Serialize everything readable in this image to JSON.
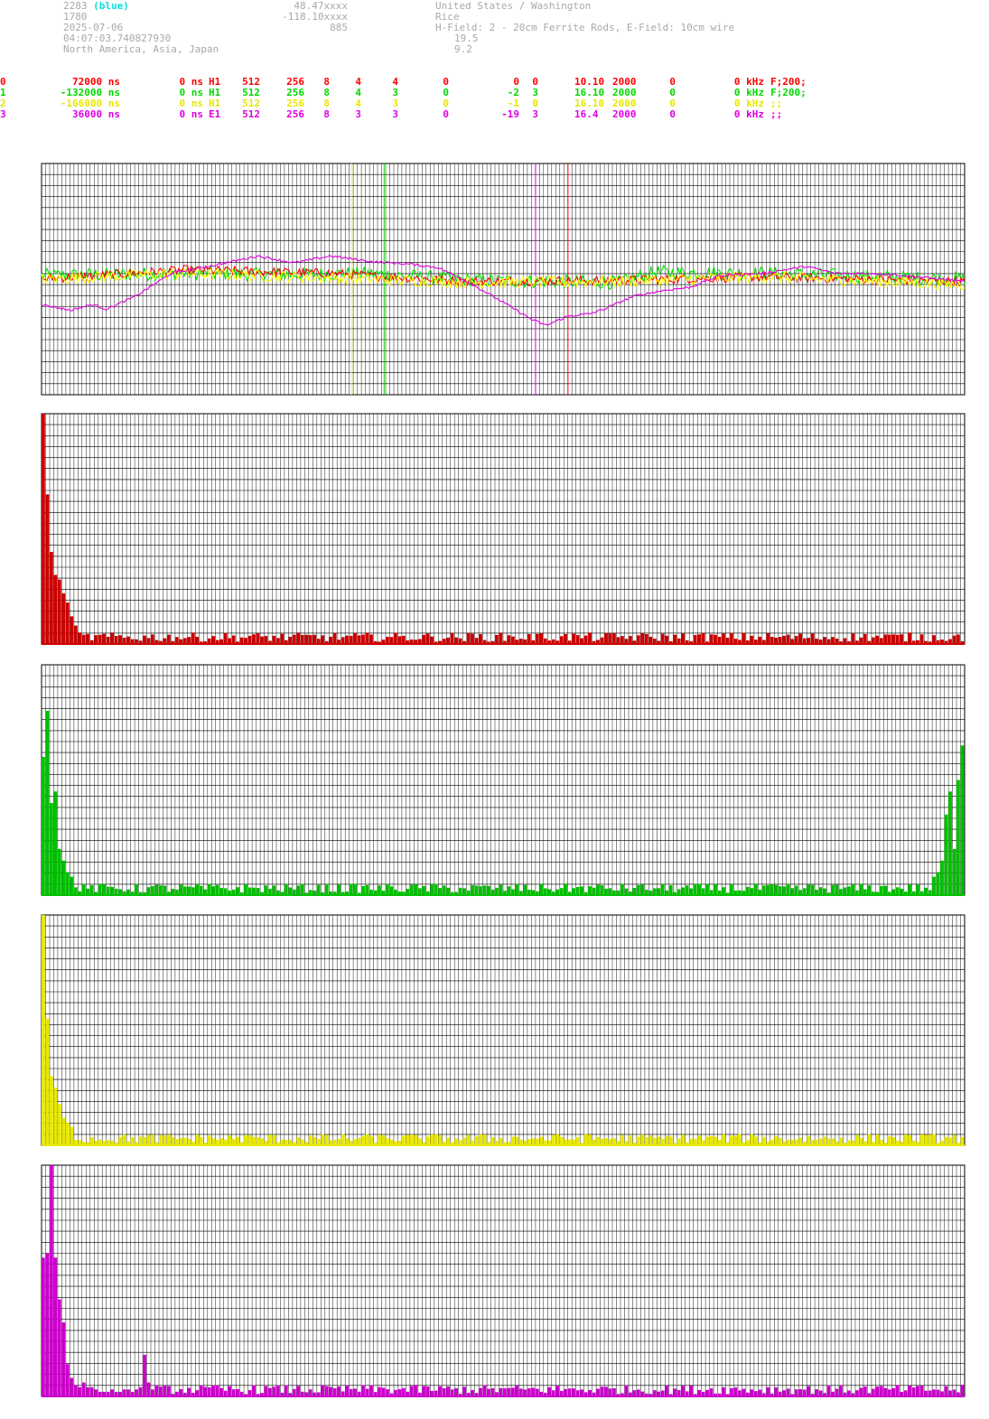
{
  "header": {
    "station_id": "2283",
    "station_color": "(blue)",
    "line2": "1780",
    "date": "2025-07-06",
    "time": "04:07:03.740827930",
    "regions": "North America, Asia, Japan",
    "lat": "48.47xxxx",
    "lon": "-118.10xxxx",
    "alt": "885",
    "location": "United States / Washington",
    "operator": "Rice",
    "antenna": "H-Field: 2 - 20cm Ferrite Rods, E-Field: 10cm wire",
    "val1": "19.5",
    "val2": "9.2"
  },
  "channels": [
    {
      "ch": "0",
      "offset": "72000 ns",
      "delay": "0 ns",
      "type": "H1",
      "a": "512",
      "b": "256",
      "c": "8",
      "d": "4",
      "e": "4",
      "f": "0",
      "g": "0",
      "h": "0",
      "freq": "10.10",
      "rate": "2000",
      "k": "0",
      "kHz": "0 kHz",
      "filter": "F;200;"
    },
    {
      "ch": "1",
      "offset": "-132000 ns",
      "delay": "0 ns",
      "type": "H1",
      "a": "512",
      "b": "256",
      "c": "8",
      "d": "4",
      "e": "3",
      "f": "0",
      "g": "-2",
      "h": "3",
      "freq": "16.10",
      "rate": "2000",
      "k": "0",
      "kHz": "0 kHz",
      "filter": "F;200;"
    },
    {
      "ch": "2",
      "offset": "-166000 ns",
      "delay": "0 ns",
      "type": "H1",
      "a": "512",
      "b": "256",
      "c": "8",
      "d": "4",
      "e": "3",
      "f": "0",
      "g": "-1",
      "h": "0",
      "freq": "16.10",
      "rate": "2000",
      "k": "0",
      "kHz": "0 kHz",
      "filter": ";;"
    },
    {
      "ch": "3",
      "offset": "36000 ns",
      "delay": "0 ns",
      "type": "E1",
      "a": "512",
      "b": "256",
      "c": "8",
      "d": "3",
      "e": "3",
      "f": "0",
      "g": "-19",
      "h": "3",
      "freq": "16.4",
      "rate": "2000",
      "k": "0",
      "kHz": "0 kHz",
      "filter": ";;"
    }
  ],
  "colors": {
    "ch0": "#ff0000",
    "ch0_bar": "#cc0000",
    "ch1": "#00e000",
    "ch1_bar": "#00c000",
    "ch2": "#ffff00",
    "ch2_bar": "#e8e800",
    "ch3": "#e000e0",
    "ch3_bar": "#cc00cc",
    "grid": "#000000"
  },
  "chart_data": [
    {
      "type": "line",
      "xlim": [
        0,
        256
      ],
      "ylim": [
        -1,
        1
      ],
      "grid": true,
      "markers": [
        {
          "channel": "2",
          "x": 86
        },
        {
          "channel": "1",
          "x": 95
        },
        {
          "channel": "3",
          "x": 137
        },
        {
          "channel": "0",
          "x": 146
        }
      ],
      "series": [
        {
          "name": "0",
          "color": "#ff0000",
          "trend": [
            [
              0,
              0.0
            ],
            [
              40,
              0.08
            ],
            [
              80,
              0.05
            ],
            [
              90,
              0.03
            ],
            [
              120,
              -0.02
            ],
            [
              160,
              -0.01
            ],
            [
              200,
              0.02
            ],
            [
              256,
              -0.02
            ]
          ],
          "noise": 0.04
        },
        {
          "name": "1",
          "color": "#00e000",
          "trend": [
            [
              0,
              0.03
            ],
            [
              40,
              0.05
            ],
            [
              70,
              0.04
            ],
            [
              90,
              0.05
            ],
            [
              120,
              -0.01
            ],
            [
              160,
              -0.03
            ],
            [
              170,
              0.06
            ],
            [
              200,
              0.05
            ],
            [
              256,
              0.0
            ]
          ],
          "noise": 0.06
        },
        {
          "name": "2",
          "color": "#ffff00",
          "trend": [
            [
              0,
              0.0
            ],
            [
              40,
              0.05
            ],
            [
              90,
              0.0
            ],
            [
              120,
              -0.03
            ],
            [
              160,
              -0.02
            ],
            [
              200,
              0.02
            ],
            [
              256,
              -0.05
            ]
          ],
          "noise": 0.05
        },
        {
          "name": "3",
          "color": "#e000e0",
          "trend": [
            [
              0,
              -0.22
            ],
            [
              8,
              -0.27
            ],
            [
              14,
              -0.22
            ],
            [
              18,
              -0.26
            ],
            [
              26,
              -0.15
            ],
            [
              36,
              0.05
            ],
            [
              48,
              0.12
            ],
            [
              60,
              0.2
            ],
            [
              70,
              0.14
            ],
            [
              80,
              0.2
            ],
            [
              92,
              0.15
            ],
            [
              102,
              0.13
            ],
            [
              110,
              0.1
            ],
            [
              118,
              -0.02
            ],
            [
              128,
              -0.2
            ],
            [
              136,
              -0.35
            ],
            [
              140,
              -0.4
            ],
            [
              146,
              -0.32
            ],
            [
              152,
              -0.3
            ],
            [
              156,
              -0.26
            ],
            [
              164,
              -0.15
            ],
            [
              172,
              -0.1
            ],
            [
              180,
              -0.07
            ],
            [
              188,
              0.03
            ],
            [
              200,
              0.05
            ],
            [
              212,
              0.11
            ],
            [
              220,
              0.05
            ],
            [
              230,
              0.05
            ],
            [
              236,
              0.04
            ],
            [
              256,
              -0.02
            ]
          ],
          "noise": 0.01
        }
      ]
    },
    {
      "type": "bar",
      "channel": "0",
      "color": "#cc0000",
      "ylim": [
        0,
        1
      ],
      "values": [
        1.0,
        0.65,
        0.4,
        0.3,
        0.28,
        0.22,
        0.18,
        0.12,
        0.08,
        0.05
      ]
    },
    {
      "type": "bar",
      "channel": "1",
      "color": "#00c000",
      "ylim": [
        0,
        1
      ],
      "values": [
        0.6,
        0.8,
        0.4,
        0.45,
        0.2,
        0.15,
        0.1,
        0.08
      ],
      "tail": [
        0.08,
        0.1,
        0.15,
        0.35,
        0.45,
        0.2,
        0.5,
        0.65
      ]
    },
    {
      "type": "bar",
      "channel": "2",
      "color": "#e8e800",
      "ylim": [
        0,
        1
      ],
      "values": [
        1.0,
        0.55,
        0.3,
        0.25,
        0.18,
        0.12,
        0.1,
        0.08
      ]
    },
    {
      "type": "bar",
      "channel": "3",
      "color": "#cc00cc",
      "ylim": [
        0,
        1
      ],
      "values": [
        0.6,
        0.62,
        1.0,
        0.6,
        0.42,
        0.32,
        0.14,
        0.08,
        0.05,
        0.04,
        0.06,
        0.04,
        0.04,
        0.03,
        0.02,
        0.02,
        0.02,
        0.03,
        0.02,
        0.02,
        0.03,
        0.03,
        0.02,
        0.03,
        0.04,
        0.18,
        0.06,
        0.03
      ]
    }
  ]
}
